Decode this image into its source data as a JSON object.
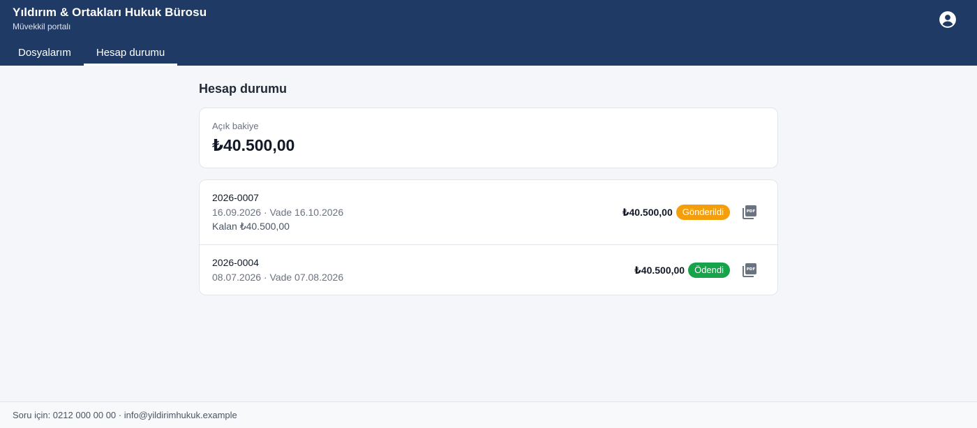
{
  "header": {
    "firm_name": "Yıldırım & Ortakları Hukuk Bürosu",
    "subtitle": "Müvekkil portalı",
    "account_icon": "account-circle-icon"
  },
  "tabs": [
    {
      "label": "Dosyalarım",
      "active": false
    },
    {
      "label": "Hesap durumu",
      "active": true
    }
  ],
  "main": {
    "title": "Hesap durumu",
    "balance": {
      "label": "Açık bakiye",
      "value": "₺40.500,00"
    },
    "invoices": [
      {
        "number": "2026-0007",
        "meta": "16.09.2026 · Vade 16.10.2026",
        "remaining": "Kalan ₺40.500,00",
        "amount": "₺40.500,00",
        "status": "Gönderildi",
        "status_color": "#f59e0b",
        "icon": "pdf-icon"
      },
      {
        "number": "2026-0004",
        "meta": "08.07.2026 · Vade 07.08.2026",
        "amount": "₺40.500,00",
        "status": "Ödendi",
        "status_color": "#16a34a",
        "icon": "pdf-icon"
      }
    ]
  },
  "footer": {
    "text": "Soru için: 0212 000 00 00 · info@yildirimhukuk.example"
  },
  "colors": {
    "header_bg": "#1f3a64",
    "page_bg": "#f5f6f9"
  }
}
